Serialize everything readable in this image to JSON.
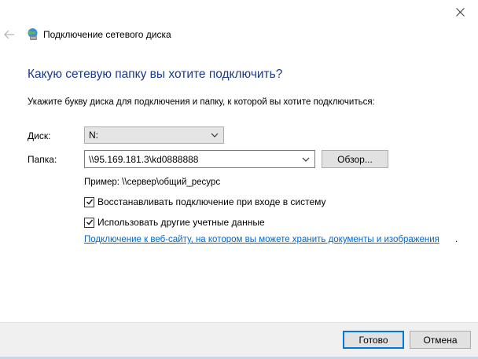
{
  "window": {
    "title": "Подключение сетевого диска",
    "close_icon": "close-icon",
    "back_icon": "back-arrow-icon",
    "title_icon": "network-drive-icon"
  },
  "main": {
    "heading": "Какую сетевую папку вы хотите подключить?",
    "instruction": "Укажите букву диска для подключения и папку, к которой вы хотите подключиться:",
    "drive_label": "Диск:",
    "drive_value": "N:",
    "folder_label": "Папка:",
    "folder_value": "\\\\95.169.181.3\\kd0888888",
    "browse_label": "Обзор...",
    "example": "Пример: \\\\сервер\\общий_ресурс",
    "reconnect_label": "Восстанавливать подключение при входе в систему",
    "reconnect_checked": true,
    "other_credentials_label": "Использовать другие учетные данные",
    "other_credentials_checked": true,
    "website_link": "Подключение к веб-сайту, на котором вы можете хранить документы и изображения",
    "website_link_suffix": "."
  },
  "footer": {
    "ok_label": "Готово",
    "cancel_label": "Отмена"
  },
  "colors": {
    "heading": "#1a3a8c",
    "link": "#0066cc",
    "focus_border": "#0078d7",
    "footer_bg": "#f0f0f0"
  }
}
